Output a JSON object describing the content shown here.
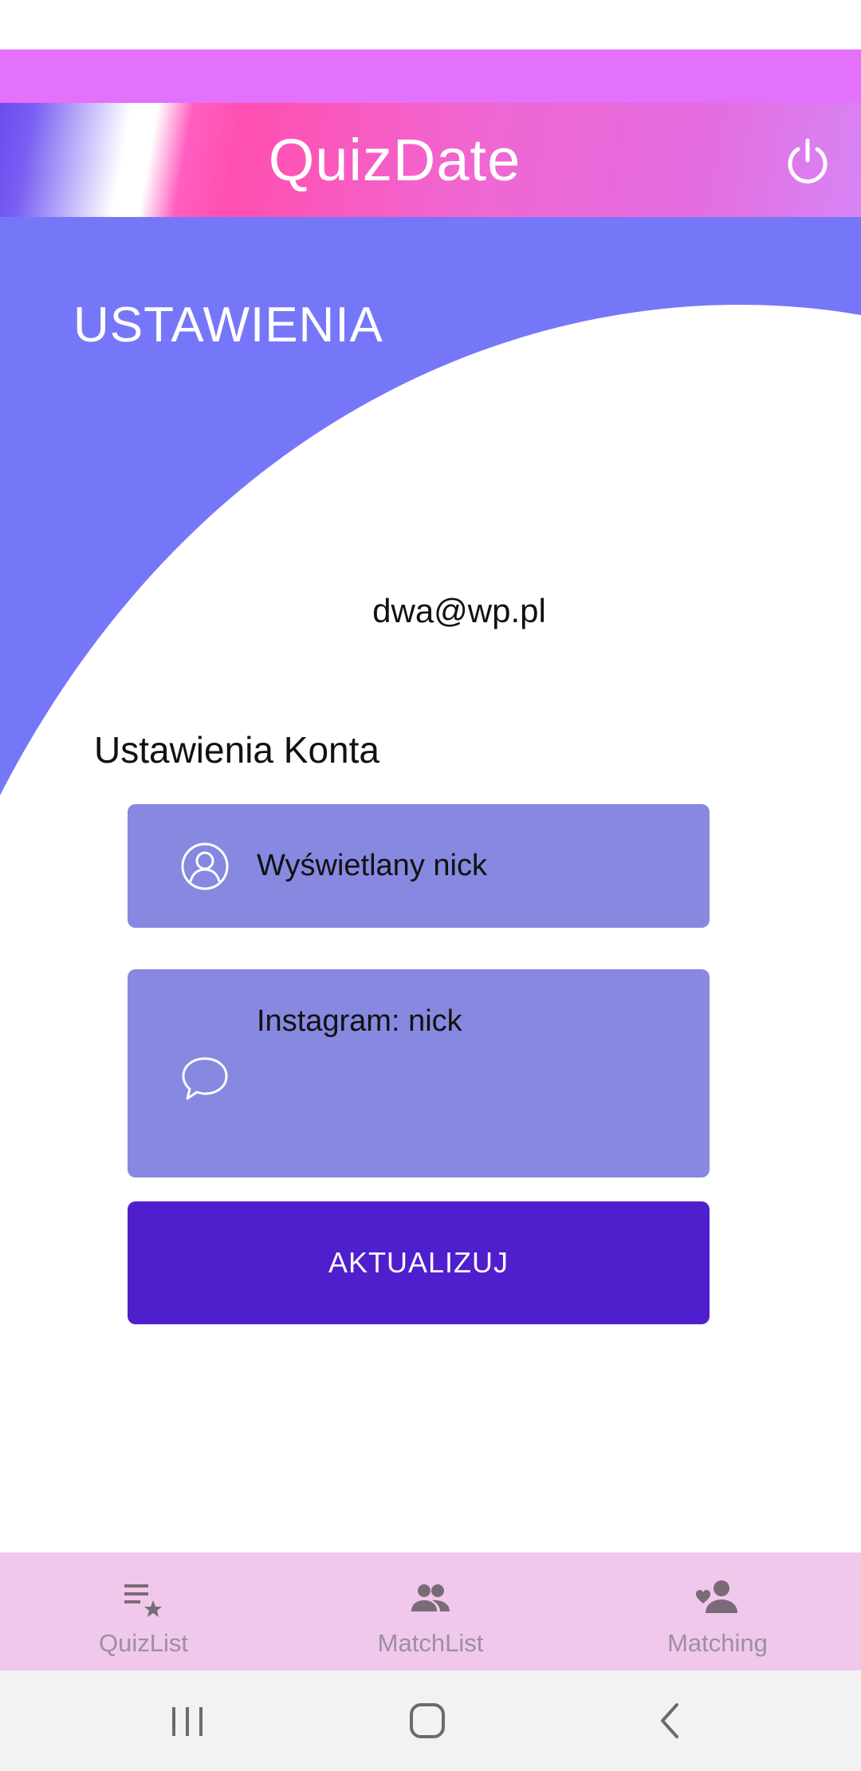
{
  "app": {
    "title": "QuizDate"
  },
  "header": {
    "section_title": "USTAWIENIA"
  },
  "profile": {
    "email": "dwa@wp.pl"
  },
  "account": {
    "heading": "Ustawienia Konta",
    "nick_field": {
      "value": "Wyświetlany nick",
      "icon": "person-outline-icon"
    },
    "instagram_field": {
      "value": "Instagram: nick",
      "icon": "chat-bubble-icon"
    },
    "update_label": "AKTUALIZUJ"
  },
  "bottom_nav": {
    "items": [
      {
        "label": "QuizList",
        "icon": "playlist-star-icon"
      },
      {
        "label": "MatchList",
        "icon": "people-icon"
      },
      {
        "label": "Matching",
        "icon": "person-heart-icon"
      }
    ]
  },
  "colors": {
    "hero_blue": "#7677f8",
    "field_bg": "#8788e0",
    "button_bg": "#4f1fce",
    "nav_bg": "#f0c8ec",
    "strip_purple": "#e371fb"
  }
}
